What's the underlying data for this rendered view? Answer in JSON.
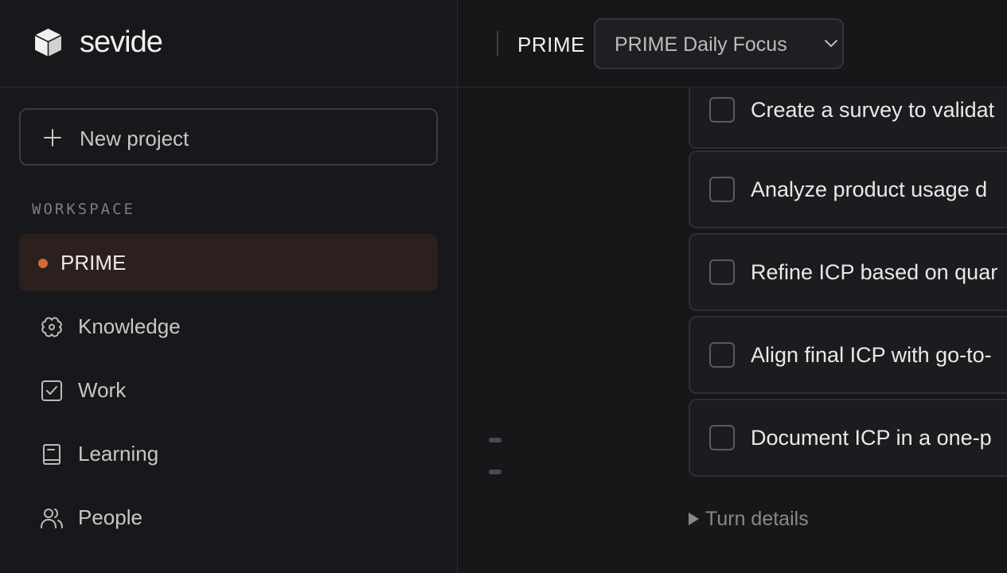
{
  "brand": {
    "name": "sevide",
    "logo_icon": "cube-icon"
  },
  "sidebar": {
    "new_project_label": "New project",
    "section_label": "WORKSPACE",
    "items": [
      {
        "label": "PRIME",
        "icon": "status-dot",
        "active": true,
        "dot_color": "#d06a3a"
      },
      {
        "label": "Knowledge",
        "icon": "brain-icon"
      },
      {
        "label": "Work",
        "icon": "checkbox-icon"
      },
      {
        "label": "Learning",
        "icon": "book-icon"
      },
      {
        "label": "People",
        "icon": "users-icon"
      }
    ]
  },
  "header": {
    "project": "PRIME",
    "session_select": {
      "value": "PRIME Daily Focus"
    }
  },
  "main": {
    "tasks": [
      {
        "text": "Create a survey to validat",
        "checked": false
      },
      {
        "text": "Analyze product usage d",
        "checked": false
      },
      {
        "text": "Refine ICP based on quar",
        "checked": false
      },
      {
        "text": "Align final ICP with go-to-",
        "checked": false
      },
      {
        "text": "Document ICP in a one-p",
        "checked": false
      }
    ],
    "turn_details_label": "Turn details"
  },
  "colors": {
    "background": "#17171a",
    "accent": "#d06a3a",
    "active_bg": "#2b201d"
  }
}
